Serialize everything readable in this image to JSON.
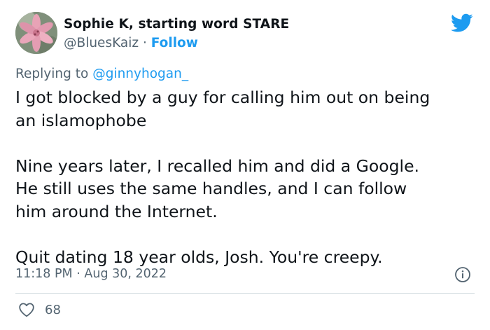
{
  "author": {
    "display_name": "Sophie K, starting word STARE",
    "handle": "@BluesKaiz",
    "separator": "·",
    "follow_label": "Follow",
    "avatar_icon": "flower-avatar"
  },
  "reply_context": {
    "prefix": "Replying to",
    "mention": "@ginnyhogan_"
  },
  "tweet": {
    "lines": [
      "I got blocked by a guy for calling him out on being",
      "an islamophobe",
      "Nine years later, I recalled him and did a Google.",
      "He still uses the same handles, and I can follow",
      "him around the Internet.",
      "Quit dating 18 year olds, Josh. You're creepy."
    ]
  },
  "meta": {
    "time": "11:18 PM",
    "separator": "·",
    "date": "Aug 30, 2022"
  },
  "actions": {
    "like_count": "68"
  },
  "icons": {
    "brand": "twitter-bird-icon",
    "info": "info-icon",
    "like": "heart-icon"
  },
  "colors": {
    "accent": "#1d9bf0",
    "secondary_text": "#536471",
    "primary_text": "#0f1419",
    "divider": "#cfd9de"
  }
}
